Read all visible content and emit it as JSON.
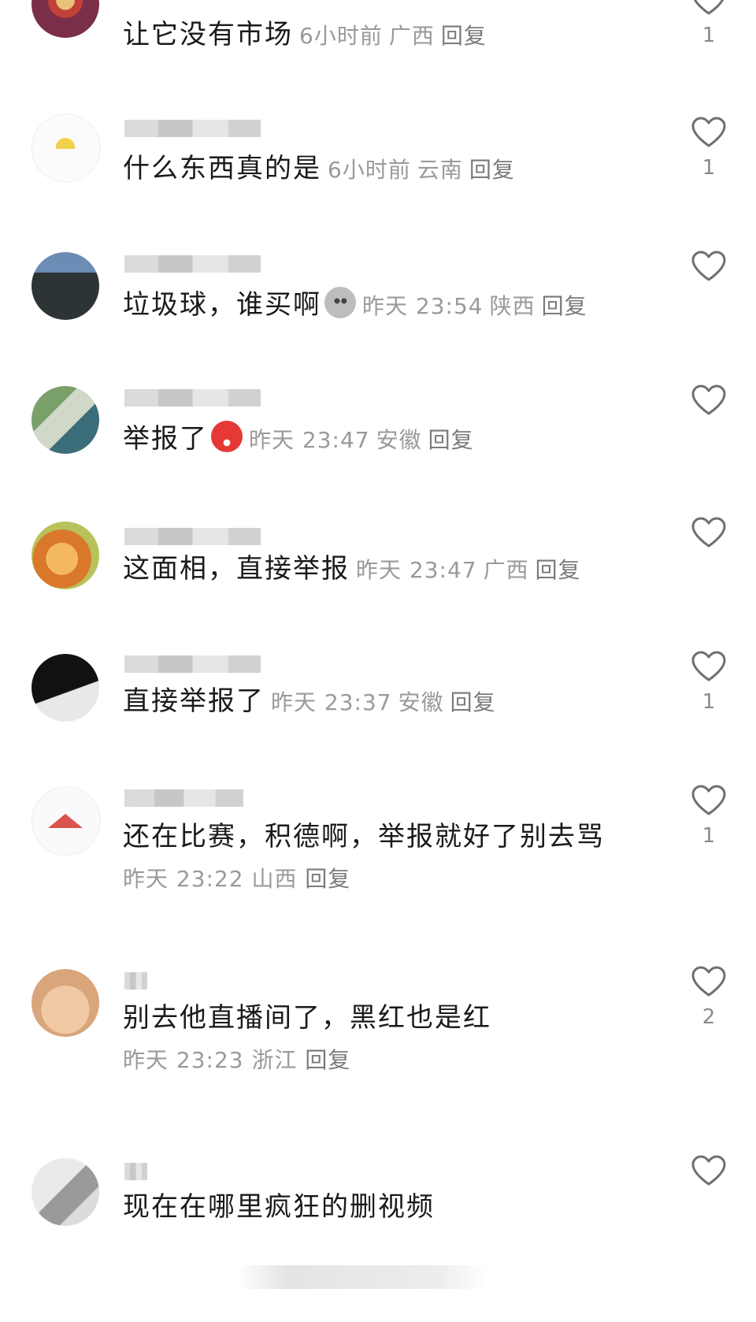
{
  "colors": {
    "meta": "#9a9a9a",
    "text": "#1a1a1a",
    "heart": "#6f6f6f"
  },
  "comments": [
    {
      "text": "让它没有市场",
      "time": "6小时前",
      "region": "广西",
      "reply": "回复",
      "likes": "1"
    },
    {
      "text": "什么东西真的是",
      "time": "6小时前",
      "region": "云南",
      "reply": "回复",
      "likes": "1"
    },
    {
      "text": "垃圾球，谁买啊",
      "time": "昨天 23:54",
      "region": "陕西",
      "reply": "回复",
      "likes": ""
    },
    {
      "text": "举报了",
      "time": "昨天 23:47",
      "region": "安徽",
      "reply": "回复",
      "likes": ""
    },
    {
      "text": "这面相，直接举报",
      "time": "昨天 23:47",
      "region": "广西",
      "reply": "回复",
      "likes": ""
    },
    {
      "text": "直接举报了",
      "time": "昨天 23:37",
      "region": "安徽",
      "reply": "回复",
      "likes": "1"
    },
    {
      "text": "还在比赛，积德啊，举报就好了别去骂",
      "time": "昨天 23:22",
      "region": "山西",
      "reply": "回复",
      "likes": "1"
    },
    {
      "text": "别去他直播间了，黑红也是红",
      "time": "昨天 23:23",
      "region": "浙江",
      "reply": "回复",
      "likes": "2"
    },
    {
      "text": "现在在哪里疯狂的删视频",
      "time": "",
      "region": "",
      "reply": "",
      "likes": ""
    }
  ]
}
